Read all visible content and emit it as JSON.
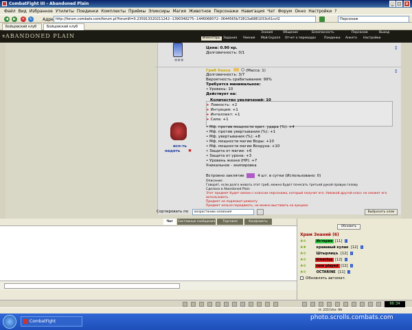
{
  "window": {
    "title": "CombatFight III - Abandoned Plain",
    "app_name": "CombatFight"
  },
  "menu": [
    "Файл",
    "Вид",
    "Избранное",
    "Утилиты",
    "Поединки",
    "Комплекты",
    "Приёмы",
    "Эликсиры",
    "Магия",
    "Животное",
    "Персонажи",
    "Навигация",
    "Чат",
    "Форум",
    "Окно",
    "Настройки",
    "?"
  ],
  "address": {
    "label": "Адрес:",
    "url": "http://forum.combats.com/forum.pl?forumR=0.235913320211242--1390348275--1446068072--3644565b72813a6881033c61ccf2"
  },
  "search": {
    "value": "Персонаж"
  },
  "tabs": [
    "Бойцовский клуб",
    "Бойцовский клуб"
  ],
  "game_header": {
    "logo": "ABANDONED PLAIN",
    "top_links": [
      "Знания",
      "Общение",
      "Безопасность",
      "Персонаж",
      "Выход"
    ],
    "bottom_links": [
      "Инвентарь",
      "Задания",
      "Умения",
      "Мой Скролл",
      "Отчет о переводах",
      "Поединки",
      "Анкета",
      "Настройки"
    ]
  },
  "item_prev": {
    "price": "Цена: 0.90 кр.",
    "durability": "Долговечность: 0/1"
  },
  "item": {
    "name": "Гриб Хаоса",
    "mass": "(Масса: 1)",
    "durability": "Долговечность: 3/7",
    "chance": "Вероятность срабатывания: 99%",
    "requirements_title": "Требуется минимальное:",
    "requirements": [
      "• Уровень: 10"
    ],
    "effects_title": "Действует на:",
    "mods_title": "Количество увеличений: 10",
    "mods": [
      "Ловкость: +2",
      "Интуиция: +1",
      "Интеллект: +1",
      "Сила: +1"
    ],
    "stats": [
      "• Мф. против мощности крит. удара (%): +4",
      "• Мф. против увертывания (%): +1",
      "• Мф. увертывания (%): +8",
      "• Мф. мощности магии Воды: +10",
      "• Мф. мощности магии Воздуха: +10",
      "• Защита от магии: +6",
      "• Защита от урона: +3",
      "• Уровень жизни (HP): +7"
    ],
    "unique": "Уникальное - экипировка",
    "embedded": "Встроено заклятие",
    "embedded_uses": "4 шт. в сутки (Использовано: 0)",
    "desc_title": "Описание:",
    "desc_lines": [
      "Говорят, если долго жевать этот гриб, можно будет почесать третьей рукой правую голову",
      "Сделано в Abandoned Plain"
    ],
    "red_lines": [
      "Этот предмет будет связан с классом персонажа, который получит его. Никакой другой класс не сможет его использовать.",
      "Предмет не подлежит ремонту",
      "Предмет нельзя передавать, но можно выставить на аукцион"
    ],
    "action_label": "исп-ть",
    "action_label2": "надеть"
  },
  "sort": {
    "label": "Сортировать по",
    "value": "возрастанию названия",
    "choose_btn": "Выбросить хлам"
  },
  "chat_tabs": [
    "Чат",
    "Системные сообщения",
    "Торговля",
    "Конфликты"
  ],
  "room": {
    "refresh": "Обновить",
    "title": "Храм Знаний (6)",
    "users": [
      {
        "name": "Истерия",
        "level": "[11]",
        "bg": "#2ecc40"
      },
      {
        "name": "крававый кулак",
        "level": "[12]",
        "bg": ""
      },
      {
        "name": "Штырлицъ",
        "level": "[12]",
        "bg": ""
      },
      {
        "name": "kinectus",
        "level": "[12]",
        "bg": "#e02020"
      },
      {
        "name": "new played",
        "level": "[12]",
        "bg": "#e02020"
      },
      {
        "name": "OCTARINE",
        "level": "[11]",
        "bg": ""
      }
    ],
    "auto_refresh": "Обновлять автомат."
  },
  "status": {
    "text": "Н: 2557/Ал: 99"
  },
  "clock": "00:34",
  "watermark": "photo.scrolls.combats.com",
  "colors": {
    "title_bar": "#0a246a",
    "header_bg": "#1b1b14",
    "room_title": "#a00000",
    "taskbar": "#1d4eb8"
  }
}
